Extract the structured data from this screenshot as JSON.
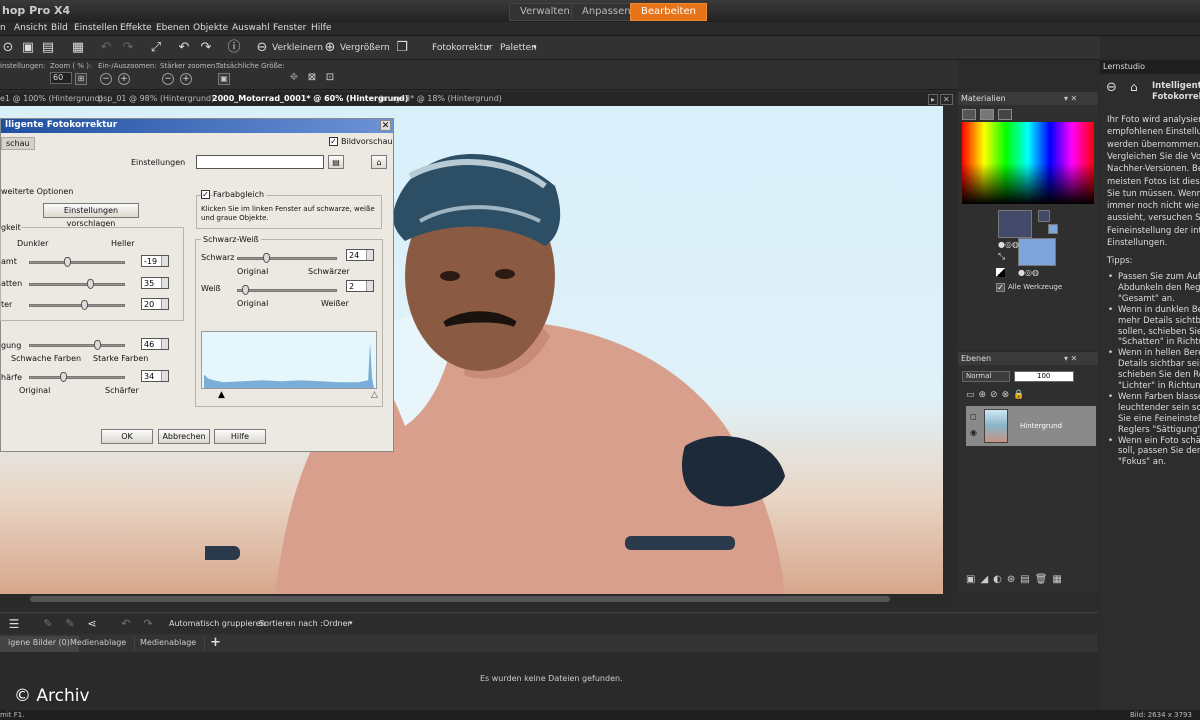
{
  "app": {
    "title": "hop Pro X4"
  },
  "modes": {
    "manage": "Verwalten",
    "adjust": "Anpassen",
    "edit": "Bearbeiten"
  },
  "menu": [
    "n",
    "Ansicht",
    "Bild",
    "Einstellen",
    "Effekte",
    "Ebenen",
    "Objekte",
    "Auswahl",
    "Fenster",
    "Hilfe"
  ],
  "toolbar": {
    "zoom_out": "Verkleinern",
    "zoom_in": "Vergrößern",
    "photo_fix": "Fotokorrektur",
    "palettes": "Paletten"
  },
  "toolbar2": {
    "presets": "instellungen:",
    "zoom_label": "Zoom ( % ):",
    "zoom_value": "60",
    "zoom_inout": "Ein-/Auszoomen:",
    "zoom_more": "Stärker zoomen:",
    "actual": "Tatsächliche Größe:"
  },
  "doctabs": [
    "e1 @ 100% (Hintergrund)",
    "psp_01 @ 98% (Hintergrund)",
    "2000_Motorrad_0001* @ 60% (Hintergrund)",
    "Image3* @ 18% (Hintergrund)"
  ],
  "dialog": {
    "title": "lligente Fotokorrektur",
    "preview_tab": "schau",
    "preview_label": "Bildvorschau",
    "presets_label": "Einstellungen",
    "advanced": "weiterte Optionen",
    "suggest_btn": "Einstellungen vorschlagen",
    "brightness": "gkeit",
    "darker": "Dunkler",
    "lighter": "Heller",
    "s1": "amt",
    "s2": "atten",
    "s3": "ter",
    "v1": "-19",
    "v2": "35",
    "v3": "20",
    "saturation": "gung",
    "sat_val": "46",
    "weak": "Schwache Farben",
    "strong": "Starke Farben",
    "focus": "härfe",
    "focus_val": "34",
    "original": "Original",
    "sharper": "Schärfer",
    "colorbal": "Farbabgleich",
    "colorbal_hint1": "Klicken Sie im linken Fenster auf schwarze, weiße",
    "colorbal_hint2": "und graue Objekte.",
    "bw": "Schwarz-Weiß",
    "black": "Schwarz",
    "black_val": "24",
    "blacker": "Schwärzer",
    "white": "Weiß",
    "white_val": "2",
    "whiter": "Weißer",
    "ok": "OK",
    "cancel": "Abbrechen",
    "help": "Hilfe"
  },
  "materials": {
    "title": "Materialien",
    "all_tools": "Alle Werkzeuge"
  },
  "layers": {
    "title": "Ebenen",
    "mode": "Normal",
    "opacity": "100",
    "layer_name": "Hintergrund"
  },
  "learn": {
    "title": "Lernstudio",
    "heading1": "Intelligente",
    "heading2": "Fotokorrek",
    "lines": [
      "Ihr Foto wird analysiert",
      "empfohlenen Einstellun",
      "werden übernommen.",
      "Vergleichen Sie die Vo",
      "Nachher-Versionen. Be",
      "meisten Fotos ist dies a",
      "Sie tun müssen. Wenn",
      "immer noch nicht wie g",
      "aussieht, versuchen Sie",
      "Feineinstellung der inte",
      "Einstellungen."
    ],
    "tips": "Tipps:",
    "bullets": [
      "Passen Sie zum Aufh",
      "Abdunkeln den Regl",
      "\"Gesamt\" an.",
      "Wenn in dunklen Ber",
      "mehr Details sichtba",
      "sollen, schieben Sie",
      "\"Schatten\" in Richtun",
      "Wenn in hellen Berei",
      "Details sichtbar sein",
      "schieben Sie den Re",
      "\"Lichter\" in Richtung",
      "Wenn Farben blasse",
      "leuchtender sein sol",
      "Sie eine Feineinstellu",
      "Reglers \"Sättigung\"",
      "Wenn ein Foto schär",
      "soll, passen Sie den",
      "\"Fokus\" an."
    ]
  },
  "organizer": {
    "auto_group": "Automatisch gruppieren",
    "sort_by": "Sortieren nach :",
    "sort_value": "Ordner",
    "tab1": "igene Bilder (0)",
    "tab2": "Medienablage",
    "tab3": "Medienablage",
    "empty": "Es wurden keine Dateien gefunden."
  },
  "status": {
    "left": "mit F1.",
    "right": "Bild:  2634 x 3793"
  },
  "watermark": "© Archiv"
}
